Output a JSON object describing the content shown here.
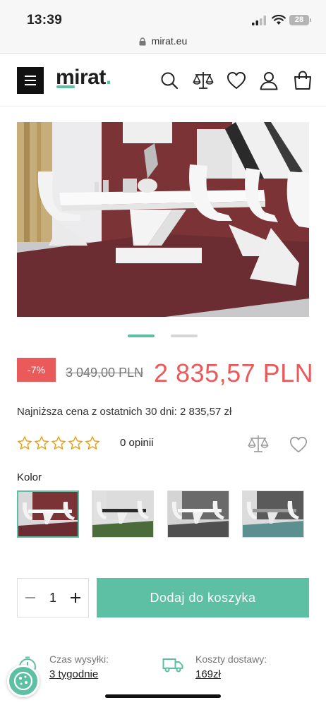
{
  "status_bar": {
    "time": "13:39",
    "battery": "28"
  },
  "browser": {
    "url": "mirat.eu"
  },
  "header": {
    "logo_text": "mirat",
    "logo_dot": ".",
    "icons": [
      "menu-icon",
      "search-icon",
      "compare-icon",
      "heart-icon",
      "user-icon",
      "bag-icon"
    ]
  },
  "gallery": {
    "slides": 2,
    "active_slide": 1
  },
  "price": {
    "discount": "-7%",
    "old_price": "3 049,00 PLN",
    "new_price": "2 835,57 PLN",
    "lowest_price_note": "Najniższa cena z ostatnich 30 dni: 2 835,57 zł"
  },
  "rating": {
    "stars": 0,
    "max_stars": 5,
    "opinions": "0 opinii"
  },
  "color": {
    "label": "Kolor",
    "options": [
      {
        "name": "white-red",
        "selected": true
      },
      {
        "name": "black-green",
        "selected": false
      },
      {
        "name": "white-grey",
        "selected": false
      },
      {
        "name": "grey-teal",
        "selected": false
      }
    ]
  },
  "cart": {
    "quantity": "1",
    "add_label": "Dodaj do koszyka"
  },
  "shipping": {
    "time_label": "Czas wysyłki:",
    "time_value": "3 tygodnie",
    "cost_label": "Koszty dostawy:",
    "cost_value": "169zł"
  },
  "colors": {
    "accent": "#5dbfa3",
    "sale": "#ea5a5a"
  }
}
